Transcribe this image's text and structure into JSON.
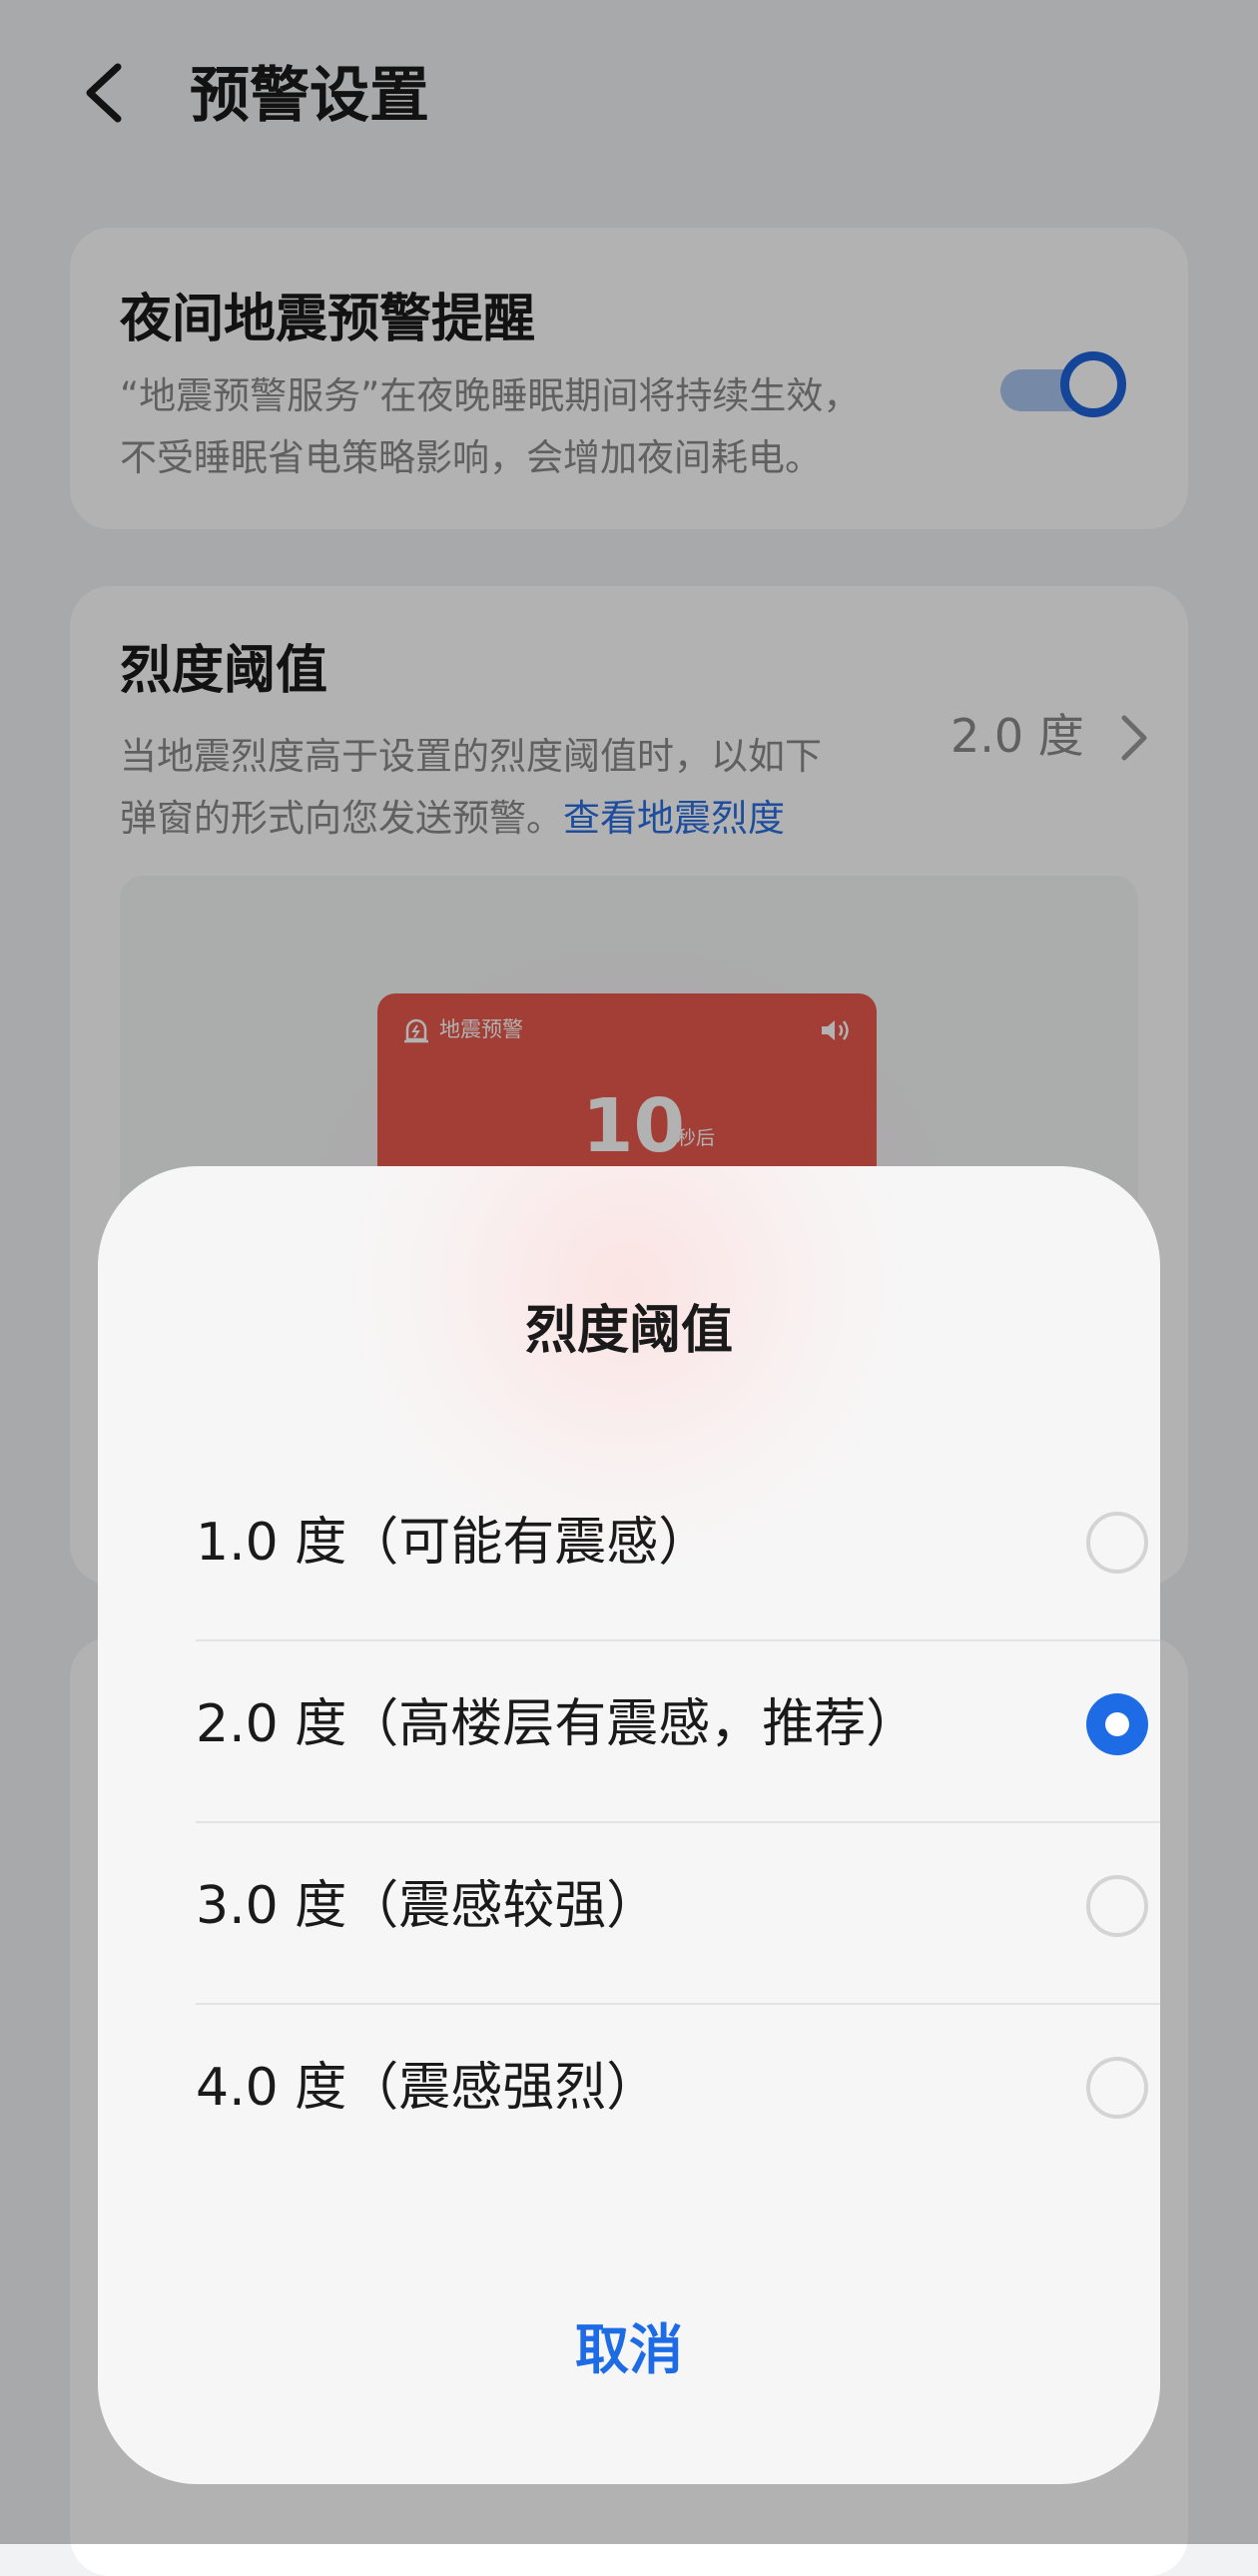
{
  "header": {
    "title": "预警设置"
  },
  "night_alert": {
    "title": "夜间地震预警提醒",
    "desc_line1": "“地震预警服务”在夜晚睡眠期间将持续生效，",
    "desc_line2": "不受睡眠省电策略影响，会增加夜间耗电。",
    "enabled": true
  },
  "threshold": {
    "title": "烈度阈值",
    "desc_line1": "当地震烈度高于设置的烈度阈值时，以如下",
    "desc_line2": "弹窗的形式向您发送预警。",
    "link": "查看地震烈度",
    "value": "2.0 度"
  },
  "preview": {
    "label": "地震预警",
    "count": "10",
    "unit": "秒后"
  },
  "dialog": {
    "title": "烈度阈值",
    "options": [
      {
        "label": "1.0 度（可能有震感）",
        "selected": false
      },
      {
        "label": "2.0 度（高楼层有震感，推荐）",
        "selected": true
      },
      {
        "label": "3.0 度（震感较强）",
        "selected": false
      },
      {
        "label": "4.0 度（震感强烈）",
        "selected": false
      }
    ],
    "cancel": "取消"
  },
  "colors": {
    "accent": "#1e6be6",
    "alert": "#e85a4c",
    "link": "#2a6fe0"
  }
}
